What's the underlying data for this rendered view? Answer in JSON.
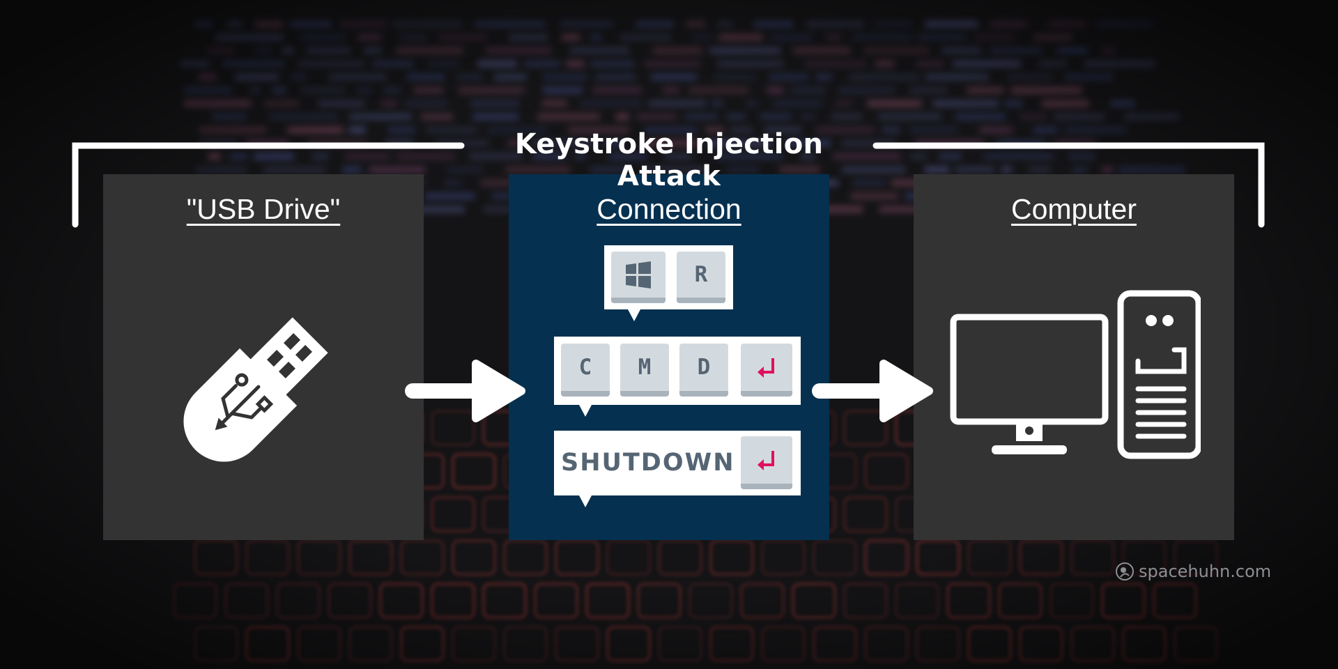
{
  "title": "Keystroke Injection Attack",
  "panels": {
    "usb": {
      "title": "\"USB Drive\"",
      "icon": "usb-stick-icon"
    },
    "connection": {
      "title": "Connection"
    },
    "computer": {
      "title": "Computer",
      "icon": "desktop-computer-icon"
    }
  },
  "keystrokes": {
    "step1": [
      "windows-logo-key",
      "R"
    ],
    "step2": [
      "C",
      "M",
      "D",
      "enter-key"
    ],
    "step3": [
      "SHUTDOWN",
      "enter-key"
    ]
  },
  "watermark": "spacehuhn.com",
  "colors": {
    "background": "#141416",
    "panel_gray": "#333333",
    "panel_blue": "#06304f",
    "key_face": "#d3dadf",
    "key_text": "#556574",
    "enter_arrow": "#e0105a"
  }
}
